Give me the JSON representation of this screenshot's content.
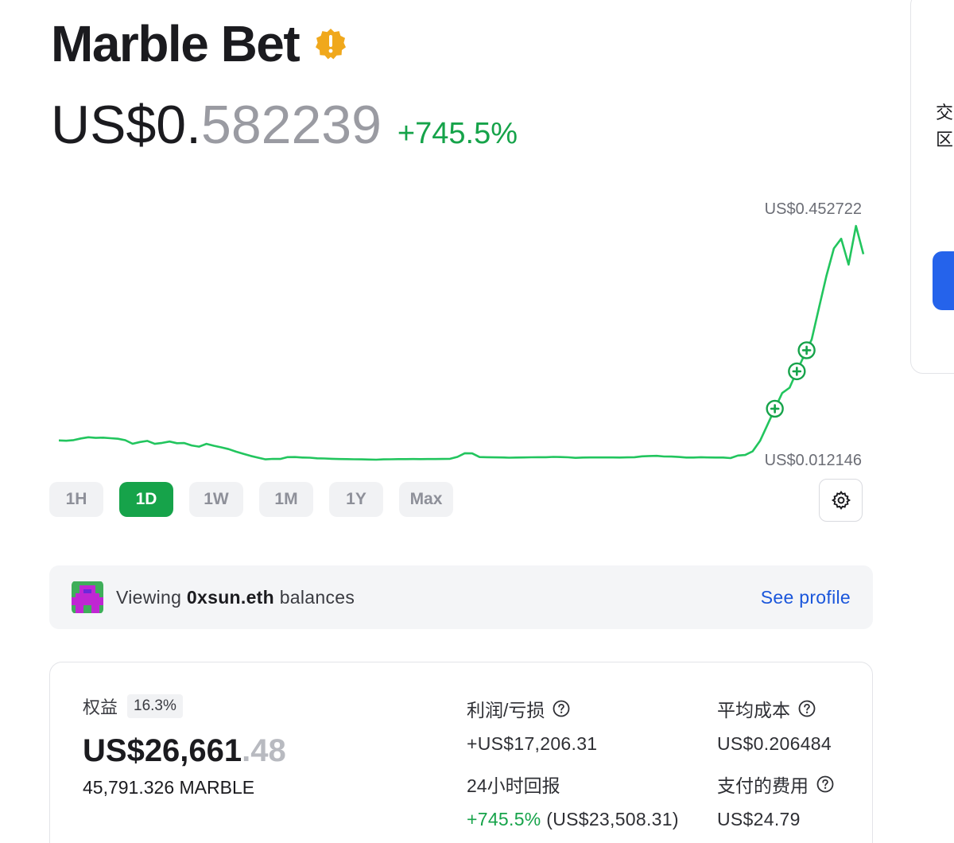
{
  "token": {
    "name": "Marble Bet",
    "warning_icon": "warning-icon",
    "price_main": "US$0.",
    "price_decimals": "582239",
    "change_pct": "+745.5%"
  },
  "chart": {
    "high_label": "US$0.452722",
    "low_label": "US$0.012146",
    "line_color": "#22c55e"
  },
  "chart_data": {
    "type": "line",
    "title": "",
    "xlabel": "",
    "ylabel": "",
    "ylim": [
      0.012146,
      0.452722
    ],
    "grid": false,
    "series": [
      {
        "values": [
          0.0512,
          0.0505,
          0.0518,
          0.0548,
          0.0571,
          0.0559,
          0.0564,
          0.0553,
          0.0542,
          0.0516,
          0.0449,
          0.0481,
          0.0503,
          0.0448,
          0.0465,
          0.0491,
          0.0459,
          0.0463,
          0.0418,
          0.0396,
          0.0448,
          0.0411,
          0.0382,
          0.0349,
          0.0302,
          0.0262,
          0.0221,
          0.0188,
          0.0157,
          0.0166,
          0.0164,
          0.0199,
          0.0201,
          0.0191,
          0.0189,
          0.0177,
          0.0174,
          0.0167,
          0.0163,
          0.0161,
          0.0159,
          0.0157,
          0.0154,
          0.0151,
          0.0157,
          0.0159,
          0.0162,
          0.0162,
          0.0163,
          0.0162,
          0.0163,
          0.0163,
          0.0164,
          0.0167,
          0.0204,
          0.0272,
          0.0269,
          0.0201,
          0.0197,
          0.0194,
          0.0193,
          0.0189,
          0.0191,
          0.0193,
          0.0196,
          0.0197,
          0.0198,
          0.0204,
          0.0201,
          0.0196,
          0.0186,
          0.0191,
          0.0193,
          0.0193,
          0.0193,
          0.0193,
          0.0191,
          0.0194,
          0.0198,
          0.0214,
          0.0219,
          0.0222,
          0.0211,
          0.0209,
          0.0202,
          0.0191,
          0.0192,
          0.0198,
          0.0193,
          0.0192,
          0.0191,
          0.0181,
          0.0228,
          0.0239,
          0.0308,
          0.0503,
          0.0802,
          0.1103,
          0.1398,
          0.1498,
          0.1809,
          0.2107,
          0.2402,
          0.3003,
          0.3596,
          0.4105,
          0.4286,
          0.3802,
          0.4526,
          0.3998
        ]
      }
    ],
    "markers": [
      {
        "value": 0.1105
      },
      {
        "value": 0.1805
      },
      {
        "value": 0.2199
      }
    ]
  },
  "ranges": [
    "1H",
    "1D",
    "1W",
    "1M",
    "1Y",
    "Max"
  ],
  "active_range": "1D",
  "viewing": {
    "prefix": "Viewing ",
    "account": "0xsun.eth",
    "suffix": " balances",
    "link": "See profile"
  },
  "position": {
    "equity_label": "权益",
    "equity_pct": "16.3%",
    "equity_value_main": "US$26,661",
    "equity_value_dec": ".48",
    "tokens": "45,791.326 MARBLE",
    "pnl_label": "利润/亏损",
    "pnl_value": "+US$17,206.31",
    "return24_label": "24小时回报",
    "return24_pct": "+745.5%",
    "return24_value": " (US$23,508.31)",
    "avg_cost_label": "平均成本",
    "avg_cost_value": "US$0.206484",
    "fees_label": "支付的费用",
    "fees_value": "US$24.79"
  },
  "right_panel": {
    "line1": "交",
    "line2": "区"
  }
}
